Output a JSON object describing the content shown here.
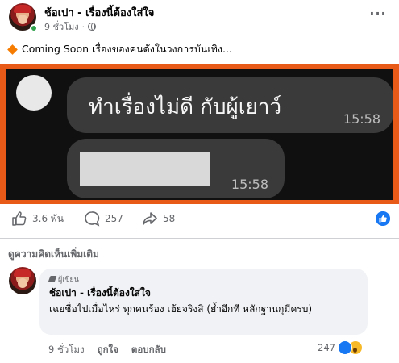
{
  "post": {
    "page_name": "ช้อเปา - เรื่องนี้ต้องใส่ใจ",
    "time": "9 ชั่วโมง",
    "more_label": "···",
    "caption": "Coming Soon เรื่องของคนดังในวงการบันเทิง...",
    "image": {
      "message1": "ทำเรื่องไม่ดี กับผู้เยาว์",
      "time1": "15:58",
      "time2": "15:58"
    },
    "stats": {
      "likes": "3.6 พัน",
      "comments": "257",
      "shares": "58"
    }
  },
  "comments_section": {
    "more_label": "ดูความคิดเห็นเพิ่มเติม",
    "comment": {
      "badge": "ผู้เขียน",
      "author": "ช้อเปา - เรื่องนี้ต้องใส่ใจ",
      "text": "เฉยชื่อไปเมื่อไหร่ ทุกคนร้อง เฮ้ยจริงสิ (ย้ำอีกที หลักฐานกุมีครบ)",
      "time": "9 ชั่วโมง",
      "like_label": "ถูกใจ",
      "reply_label": "ตอบกลับ",
      "reaction_count": "247"
    }
  },
  "colors": {
    "accent": "#1877f2",
    "image_border": "#e75a18",
    "online": "#31a24c"
  }
}
